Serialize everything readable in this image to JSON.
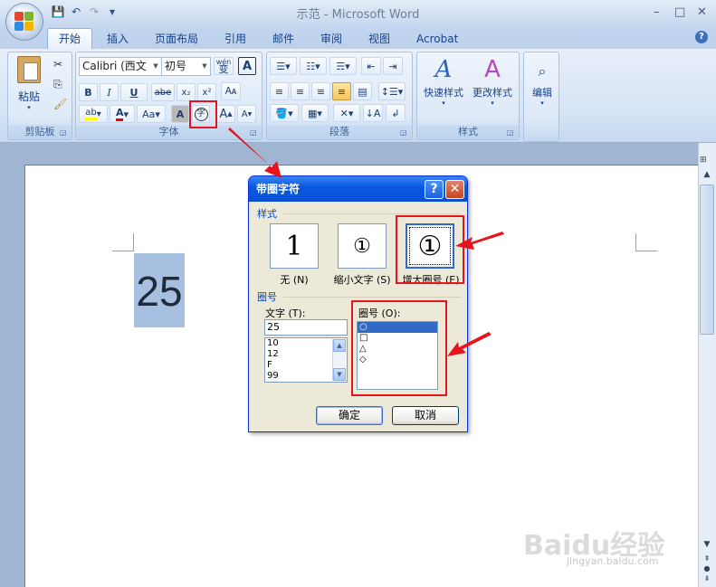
{
  "window": {
    "title": "示范 - Microsoft Word",
    "minimize": "–",
    "maximize": "□",
    "close": "✕"
  },
  "qat": {
    "save_icon": "save-icon",
    "undo_icon": "undo-icon",
    "redo_icon": "redo-icon",
    "customize": "▾"
  },
  "tabs": [
    "开始",
    "插入",
    "页面布局",
    "引用",
    "邮件",
    "审阅",
    "视图",
    "Acrobat"
  ],
  "help": "?",
  "ribbon": {
    "clipboard": {
      "label": "剪贴板",
      "paste": "粘贴"
    },
    "font": {
      "label": "字体",
      "font_name": "Calibri (西文",
      "font_size": "初号",
      "wen": "wén",
      "wen_char": "变",
      "bold": "B",
      "italic": "I",
      "underline": "U",
      "strike": "abe",
      "sub": "x₂",
      "sup": "x²",
      "aa": "Aa",
      "shade": "A",
      "enclose": "字",
      "grow": "A",
      "shrink": "A"
    },
    "paragraph": {
      "label": "段落"
    },
    "styles": {
      "label": "样式",
      "quick": "快速样式",
      "change": "更改样式"
    },
    "editing": {
      "label": "编辑"
    }
  },
  "document": {
    "selected_text": "25"
  },
  "dialog": {
    "title": "带圈字符",
    "help_btn": "?",
    "close_btn": "✕",
    "style_section": "样式",
    "styles": [
      {
        "glyph": "1",
        "label": "无 (N)"
      },
      {
        "glyph": "①",
        "label": "缩小文字 (S)"
      },
      {
        "glyph": "①",
        "label": "增大圈号 (E)"
      }
    ],
    "enclosure_section": "圈号",
    "text_label": "文字 (T):",
    "text_value": "25",
    "text_items": [
      "10",
      "12",
      "F",
      "99"
    ],
    "enclosure_label": "圈号 (O):",
    "enclosure_items": [
      "○",
      "□",
      "△",
      "◇"
    ],
    "ok": "确定",
    "cancel": "取消"
  },
  "watermark": {
    "brand": "Baidu经验",
    "url": "jingyan.baidu.com"
  }
}
